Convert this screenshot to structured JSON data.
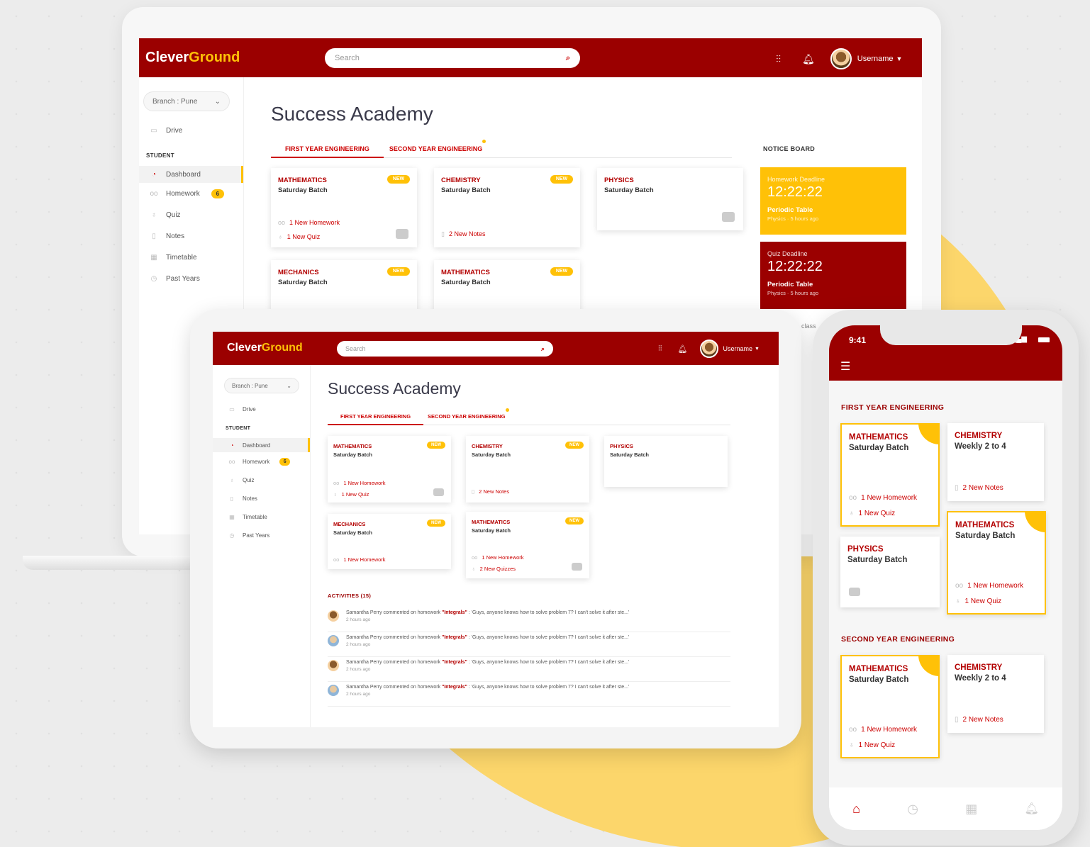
{
  "brand": {
    "name_a": "Clever",
    "name_b": "Ground"
  },
  "search": {
    "placeholder": "Search"
  },
  "user": {
    "name": "Username"
  },
  "branch": {
    "label": "Branch : Pune"
  },
  "sidebar": {
    "drive": "Drive",
    "section": "STUDENT",
    "items": [
      {
        "label": "Dashboard"
      },
      {
        "label": "Homework",
        "badge": "6"
      },
      {
        "label": "Quiz"
      },
      {
        "label": "Notes"
      },
      {
        "label": "Timetable"
      },
      {
        "label": "Past Years"
      }
    ]
  },
  "main": {
    "title": "Success Academy",
    "tabs": [
      "FIRST YEAR ENGINEERING",
      "SECOND YEAR ENGINEERING"
    ],
    "notice_title": "NOTICE BOARD",
    "new_label": "NEW",
    "batch": "Saturday Batch",
    "cards": [
      {
        "subject": "MATHEMATICS",
        "line1": "1 New Homework",
        "line2": "1 New Quiz"
      },
      {
        "subject": "CHEMISTRY",
        "line1": "2 New Notes"
      },
      {
        "subject": "PHYSICS"
      },
      {
        "subject": "MECHANICS",
        "line1": "1 New Homework"
      },
      {
        "subject": "MATHEMATICS",
        "line1": "1 New Homework",
        "line2": "2 New Quizzes"
      }
    ],
    "notices": [
      {
        "label": "Homework Deadline",
        "time": "12:22:22",
        "topic": "Periodic Table",
        "meta": "Physics · 5 hours ago"
      },
      {
        "label": "Quiz Deadline",
        "time": "12:22:22",
        "topic": "Periodic Table",
        "meta": "Physics · 5 hours ago"
      }
    ],
    "activities_title": "ACTIVITIES (15)",
    "activity": {
      "pre": "Samantha Perry commented on homework ",
      "hw": "\"Integrals\"",
      "post": " : 'Guys, anyone knows how to solve problem 7?  I can't solve it after ste...'",
      "time": "2 hours ago"
    },
    "behind_text": "class"
  },
  "phone": {
    "time": "9:41",
    "sections": [
      "FIRST YEAR ENGINEERING",
      "SECOND YEAR ENGINEERING"
    ],
    "cards": [
      {
        "subject": "MATHEMATICS",
        "batch": "Saturday Batch",
        "line1": "1 New Homework",
        "line2": "1 New Quiz"
      },
      {
        "subject": "CHEMISTRY",
        "batch": "Weekly 2 to 4",
        "line1": "2 New Notes"
      },
      {
        "subject": "PHYSICS",
        "batch": "Saturday Batch"
      },
      {
        "subject": "MATHEMATICS",
        "batch": "Saturday Batch",
        "line1": "1 New Homework",
        "line2": "1 New Quiz"
      },
      {
        "subject": "MATHEMATICS",
        "batch": "Saturday Batch",
        "line1": "1 New Homework",
        "line2": "1 New Quiz"
      },
      {
        "subject": "CHEMISTRY",
        "batch": "Weekly 2 to 4",
        "line1": "2 New Notes"
      }
    ]
  },
  "colors": {
    "brand_red": "#9b0000",
    "accent_yellow": "#ffc107",
    "blob": "#fcd66b"
  }
}
